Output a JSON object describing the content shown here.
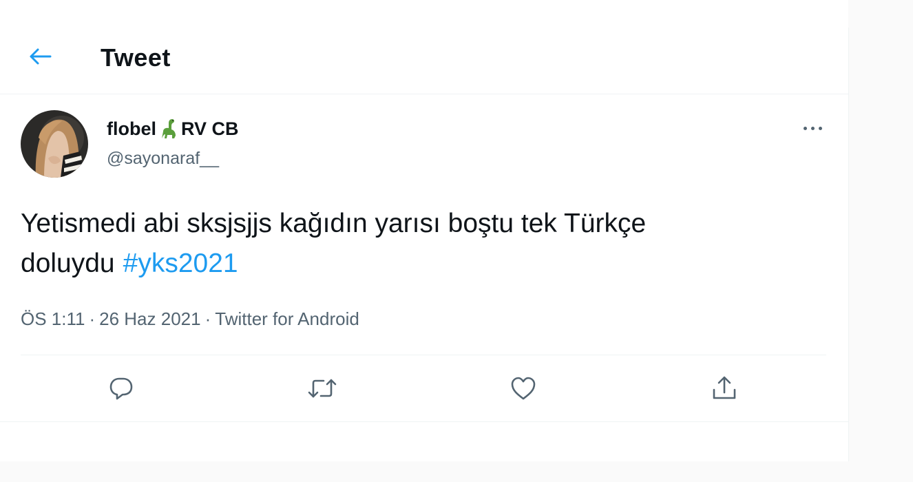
{
  "header": {
    "back_icon": "arrow-left-icon",
    "title": "Tweet",
    "accent_color": "#1d9bf0"
  },
  "tweet": {
    "author": {
      "name": "flobel",
      "name_suffix": "RV CB",
      "name_emoji": "sauropod-emoji",
      "handle": "@sayonaraf__"
    },
    "text": "Yetismedi abi sksjsjjs kağıdın yarısı boştu tek Türkçe doluydu",
    "hashtag": "#yks2021",
    "time": "ÖS 1:11",
    "date": "26 Haz 2021",
    "source": "Twitter for Android",
    "separator": "·",
    "more_icon": "more-horizontal-icon"
  },
  "actions": [
    {
      "name": "reply",
      "icon": "reply-icon"
    },
    {
      "name": "retweet",
      "icon": "retweet-icon"
    },
    {
      "name": "like",
      "icon": "heart-icon"
    },
    {
      "name": "share",
      "icon": "share-icon"
    }
  ]
}
